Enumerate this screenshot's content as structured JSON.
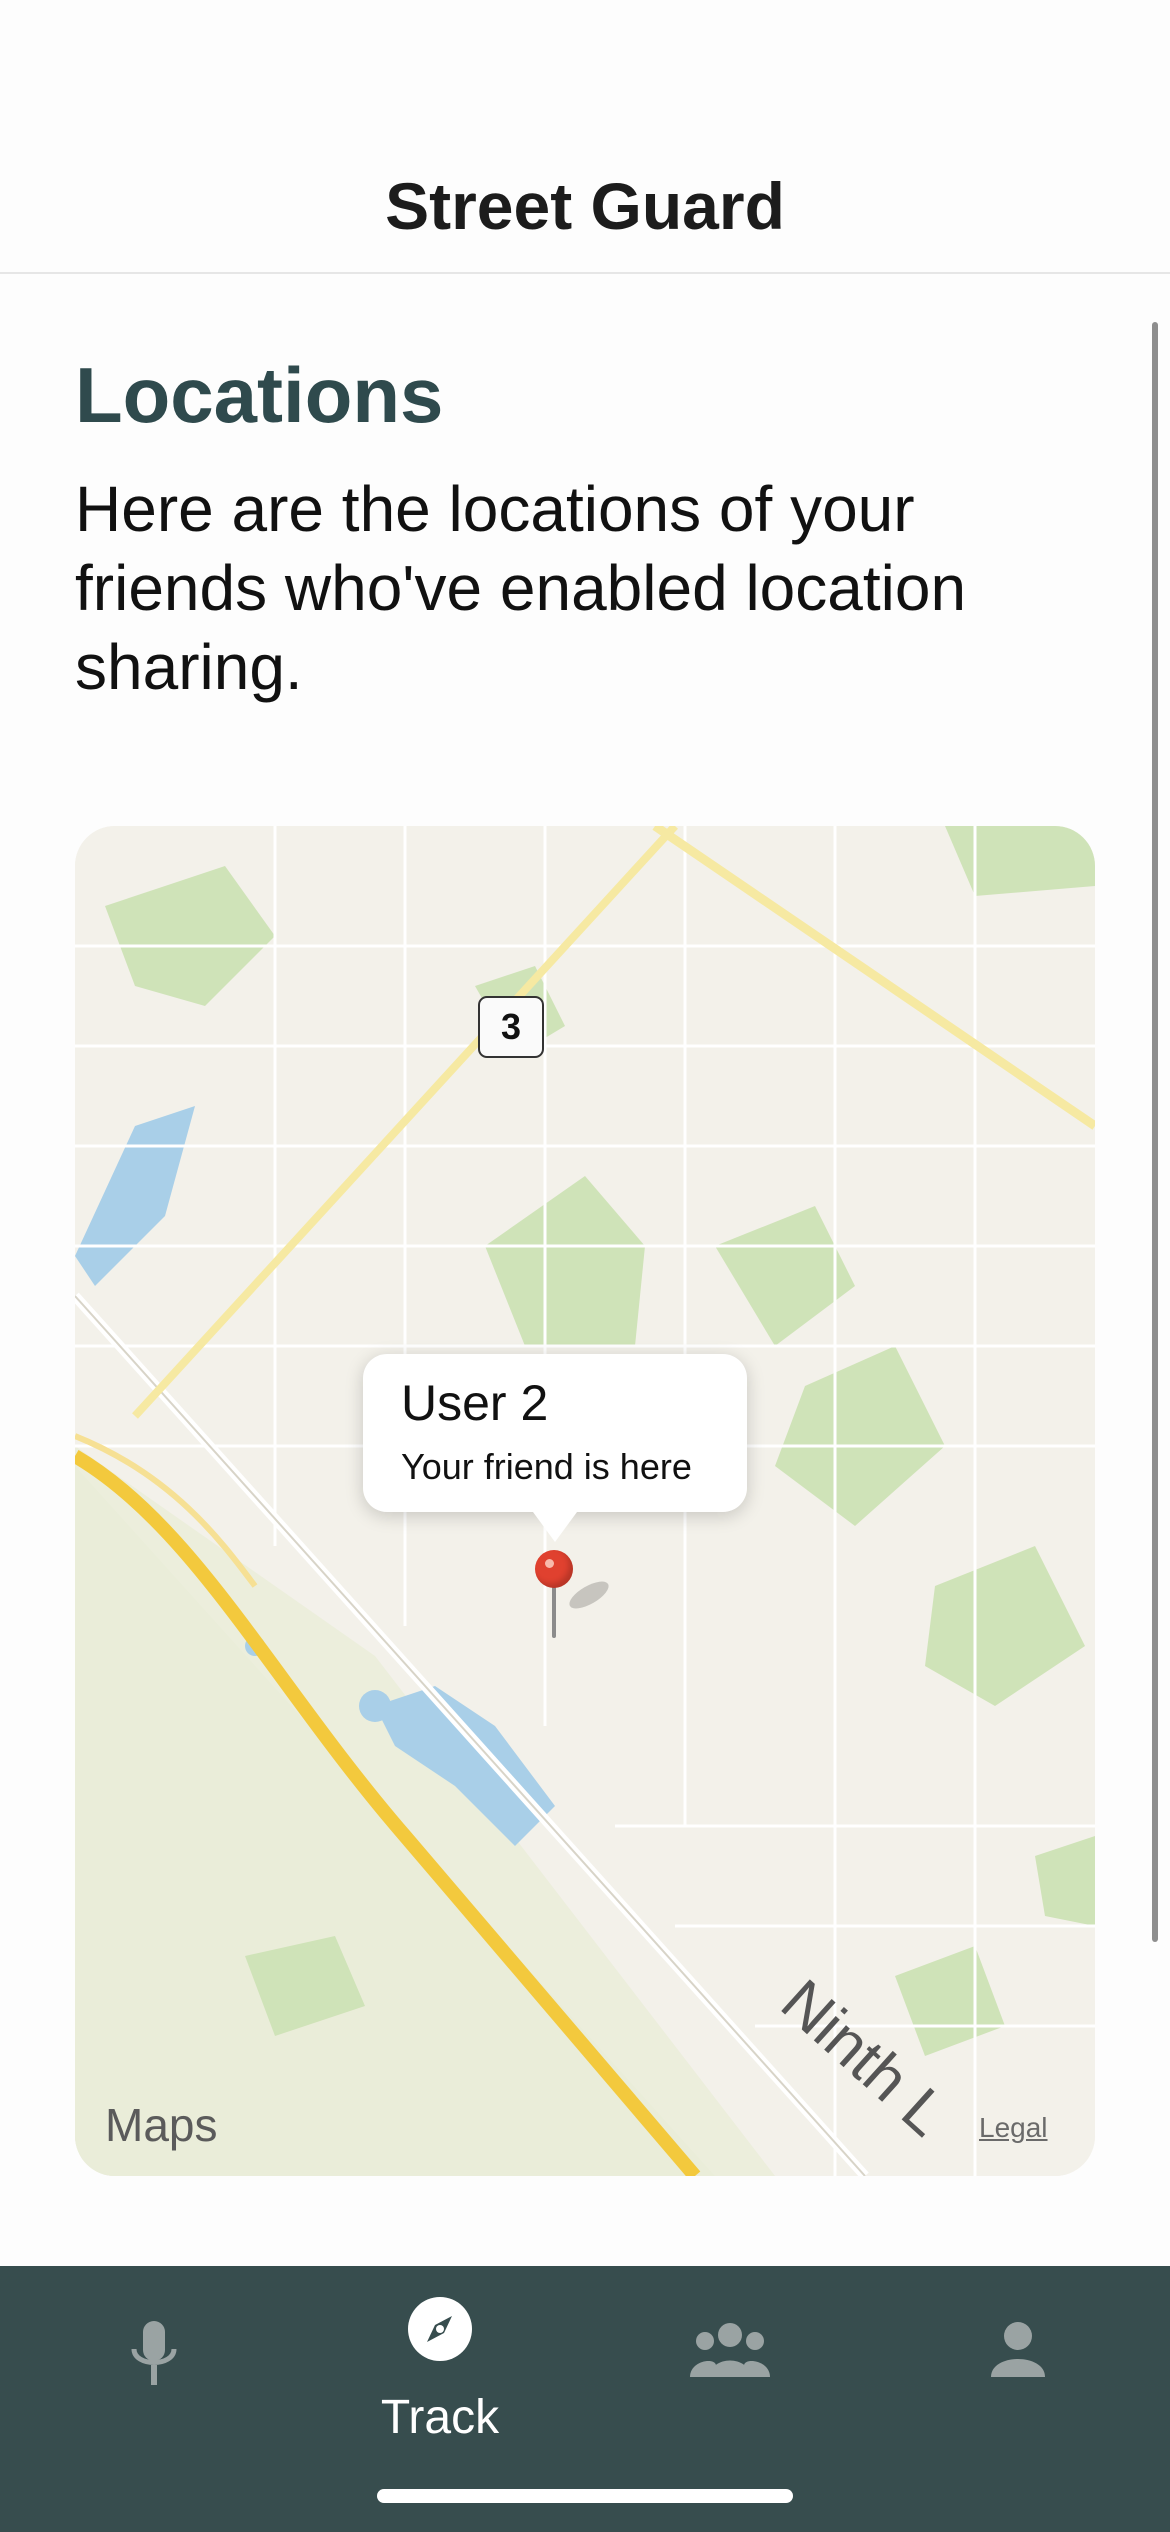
{
  "header": {
    "title": "Street Guard"
  },
  "main": {
    "title": "Locations",
    "description": "Here are the locations of your friends who've enabled location sharing."
  },
  "map": {
    "route_badge": "3",
    "callout": {
      "title": "User 2",
      "subtitle": "Your friend is here"
    },
    "street_label": "Ninth L",
    "logo_symbol": "",
    "logo_text": "Maps",
    "legal_link": "Legal"
  },
  "tabbar": {
    "items": [
      {
        "icon": "microphone-icon",
        "label": ""
      },
      {
        "icon": "compass-icon",
        "label": "Track",
        "active": true
      },
      {
        "icon": "group-icon",
        "label": ""
      },
      {
        "icon": "person-icon",
        "label": ""
      }
    ]
  },
  "colors": {
    "accent": "#2f4a4d",
    "tabbar_bg": "#374d4e",
    "pin": "#e0412f",
    "status_dot": "#f7d447"
  }
}
